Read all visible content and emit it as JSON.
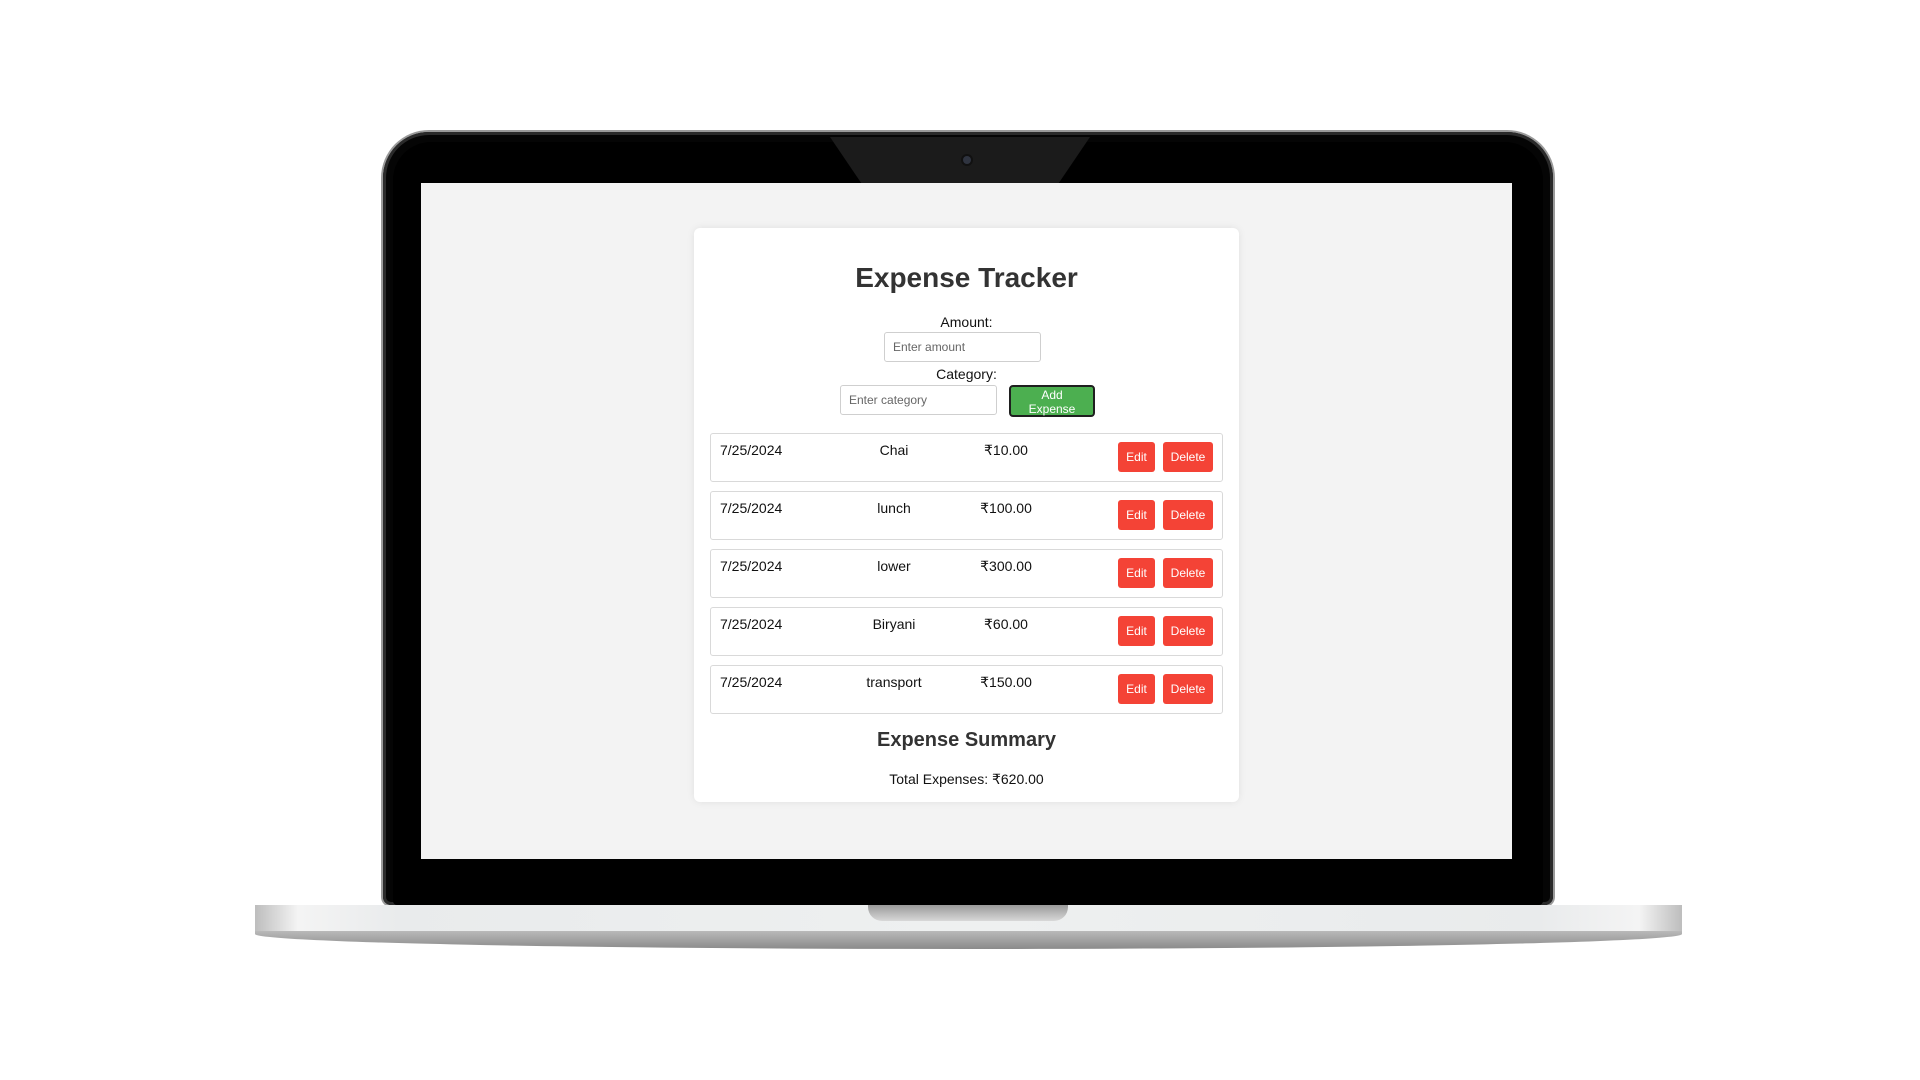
{
  "app": {
    "title": "Expense Tracker"
  },
  "form": {
    "amount_label": "Amount:",
    "amount_placeholder": "Enter amount",
    "amount_value": "",
    "category_label": "Category:",
    "category_placeholder": "Enter category",
    "category_value": "",
    "add_button_label": "Add Expense"
  },
  "expenses": [
    {
      "date": "7/25/2024",
      "category": "Chai",
      "amount": "₹10.00",
      "edit_label": "Edit",
      "delete_label": "Delete"
    },
    {
      "date": "7/25/2024",
      "category": "lunch",
      "amount": "₹100.00",
      "edit_label": "Edit",
      "delete_label": "Delete"
    },
    {
      "date": "7/25/2024",
      "category": "lower",
      "amount": "₹300.00",
      "edit_label": "Edit",
      "delete_label": "Delete"
    },
    {
      "date": "7/25/2024",
      "category": "Biryani",
      "amount": "₹60.00",
      "edit_label": "Edit",
      "delete_label": "Delete"
    },
    {
      "date": "7/25/2024",
      "category": "transport",
      "amount": "₹150.00",
      "edit_label": "Edit",
      "delete_label": "Delete"
    }
  ],
  "summary": {
    "title": "Expense Summary",
    "total_text": "Total Expenses: ₹620.00"
  },
  "colors": {
    "add_button": "#4caf50",
    "danger_button": "#f44336",
    "screen_bg": "#f3f3f3"
  }
}
